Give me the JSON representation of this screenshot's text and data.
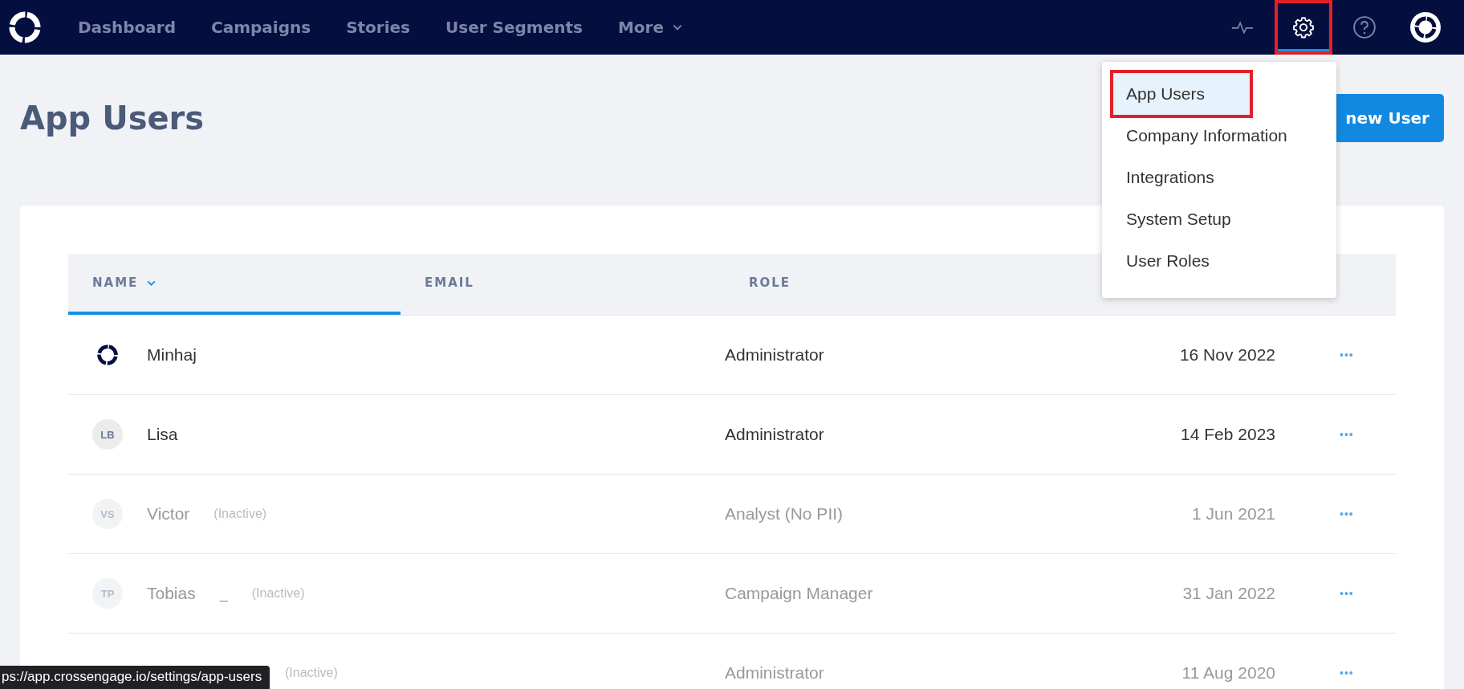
{
  "nav": {
    "items": [
      {
        "label": "Dashboard",
        "kind": "link"
      },
      {
        "label": "Campaigns",
        "kind": "link"
      },
      {
        "label": "Stories",
        "kind": "link"
      },
      {
        "label": "User Segments",
        "kind": "link"
      },
      {
        "label": "More",
        "kind": "dropdown"
      }
    ],
    "tools": [
      {
        "kind": "activity",
        "selected": false,
        "annotated": false
      },
      {
        "kind": "settings",
        "selected": true,
        "annotated": true
      },
      {
        "kind": "help",
        "selected": false,
        "annotated": false
      },
      {
        "kind": "avatar",
        "selected": false,
        "annotated": false
      }
    ]
  },
  "page": {
    "title": "App Users",
    "button": "new User"
  },
  "settings_menu": {
    "items": [
      {
        "label": "App Users",
        "selected": true,
        "annotated": true
      },
      {
        "label": "Company Information",
        "selected": false,
        "annotated": false
      },
      {
        "label": "Integrations",
        "selected": false,
        "annotated": false
      },
      {
        "label": "System Setup",
        "selected": false,
        "annotated": false
      },
      {
        "label": "User Roles",
        "selected": false,
        "annotated": false
      }
    ]
  },
  "table": {
    "columns": [
      {
        "label": "NAME",
        "sorted": true
      },
      {
        "label": "EMAIL",
        "sorted": false
      },
      {
        "label": "ROLE",
        "sorted": false
      }
    ],
    "rows": [
      {
        "avatar": {
          "kind": "logo"
        },
        "name": "Minhaj",
        "inactive": false,
        "role": "Administrator",
        "date": "16 Nov 2022",
        "actions": "•••"
      },
      {
        "avatar": {
          "kind": "initials",
          "text": "LB"
        },
        "name": "Lisa",
        "inactive": false,
        "role": "Administrator",
        "date": "14 Feb 2023",
        "actions": "•••"
      },
      {
        "avatar": {
          "kind": "initials",
          "text": "VS"
        },
        "name": "Victor",
        "inactive": true,
        "status": "(Inactive)",
        "role": "Analyst (No PII)",
        "date": "1 Jun 2021",
        "actions": "•••"
      },
      {
        "avatar": {
          "kind": "initials",
          "text": "TP"
        },
        "name": "Tobias",
        "name_extra": "_",
        "inactive": true,
        "status": "(Inactive)",
        "role": "Campaign Manager",
        "date": "31 Jan 2022",
        "actions": "•••"
      },
      {
        "inactive": true,
        "status": "(Inactive)",
        "role": "Administrator",
        "date": "11 Aug 2020",
        "actions": "•••"
      }
    ]
  },
  "link_preview": "ps://app.crossengage.io/settings/app-users"
}
